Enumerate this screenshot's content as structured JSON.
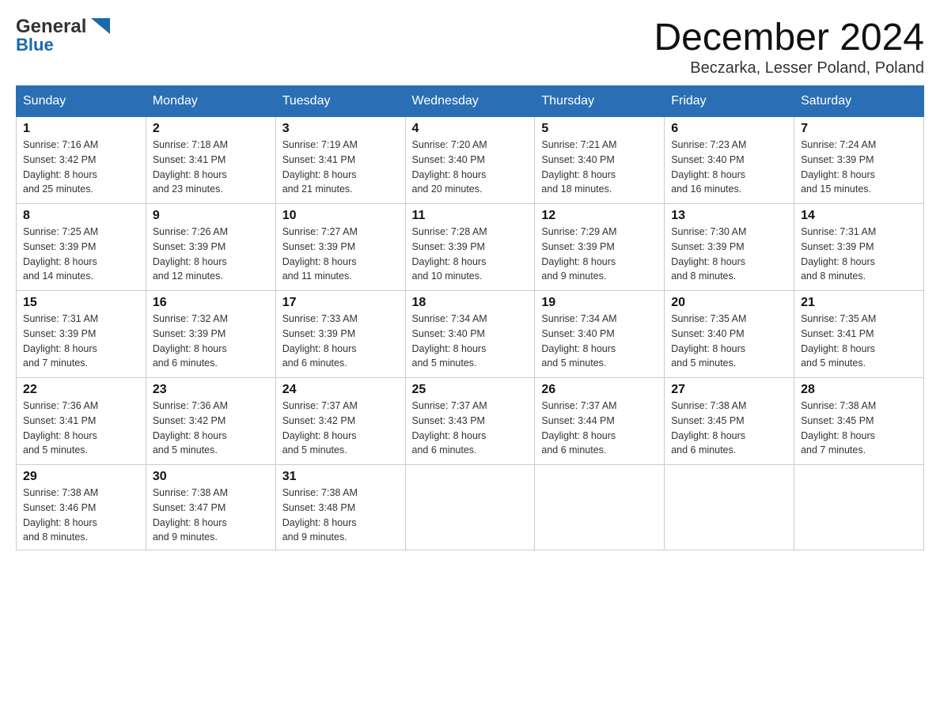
{
  "logo": {
    "general": "General",
    "blue": "Blue"
  },
  "title": "December 2024",
  "subtitle": "Beczarka, Lesser Poland, Poland",
  "days": [
    "Sunday",
    "Monday",
    "Tuesday",
    "Wednesday",
    "Thursday",
    "Friday",
    "Saturday"
  ],
  "weeks": [
    [
      {
        "num": "1",
        "sunrise": "7:16 AM",
        "sunset": "3:42 PM",
        "daylight": "8 hours and 25 minutes."
      },
      {
        "num": "2",
        "sunrise": "7:18 AM",
        "sunset": "3:41 PM",
        "daylight": "8 hours and 23 minutes."
      },
      {
        "num": "3",
        "sunrise": "7:19 AM",
        "sunset": "3:41 PM",
        "daylight": "8 hours and 21 minutes."
      },
      {
        "num": "4",
        "sunrise": "7:20 AM",
        "sunset": "3:40 PM",
        "daylight": "8 hours and 20 minutes."
      },
      {
        "num": "5",
        "sunrise": "7:21 AM",
        "sunset": "3:40 PM",
        "daylight": "8 hours and 18 minutes."
      },
      {
        "num": "6",
        "sunrise": "7:23 AM",
        "sunset": "3:40 PM",
        "daylight": "8 hours and 16 minutes."
      },
      {
        "num": "7",
        "sunrise": "7:24 AM",
        "sunset": "3:39 PM",
        "daylight": "8 hours and 15 minutes."
      }
    ],
    [
      {
        "num": "8",
        "sunrise": "7:25 AM",
        "sunset": "3:39 PM",
        "daylight": "8 hours and 14 minutes."
      },
      {
        "num": "9",
        "sunrise": "7:26 AM",
        "sunset": "3:39 PM",
        "daylight": "8 hours and 12 minutes."
      },
      {
        "num": "10",
        "sunrise": "7:27 AM",
        "sunset": "3:39 PM",
        "daylight": "8 hours and 11 minutes."
      },
      {
        "num": "11",
        "sunrise": "7:28 AM",
        "sunset": "3:39 PM",
        "daylight": "8 hours and 10 minutes."
      },
      {
        "num": "12",
        "sunrise": "7:29 AM",
        "sunset": "3:39 PM",
        "daylight": "8 hours and 9 minutes."
      },
      {
        "num": "13",
        "sunrise": "7:30 AM",
        "sunset": "3:39 PM",
        "daylight": "8 hours and 8 minutes."
      },
      {
        "num": "14",
        "sunrise": "7:31 AM",
        "sunset": "3:39 PM",
        "daylight": "8 hours and 8 minutes."
      }
    ],
    [
      {
        "num": "15",
        "sunrise": "7:31 AM",
        "sunset": "3:39 PM",
        "daylight": "8 hours and 7 minutes."
      },
      {
        "num": "16",
        "sunrise": "7:32 AM",
        "sunset": "3:39 PM",
        "daylight": "8 hours and 6 minutes."
      },
      {
        "num": "17",
        "sunrise": "7:33 AM",
        "sunset": "3:39 PM",
        "daylight": "8 hours and 6 minutes."
      },
      {
        "num": "18",
        "sunrise": "7:34 AM",
        "sunset": "3:40 PM",
        "daylight": "8 hours and 5 minutes."
      },
      {
        "num": "19",
        "sunrise": "7:34 AM",
        "sunset": "3:40 PM",
        "daylight": "8 hours and 5 minutes."
      },
      {
        "num": "20",
        "sunrise": "7:35 AM",
        "sunset": "3:40 PM",
        "daylight": "8 hours and 5 minutes."
      },
      {
        "num": "21",
        "sunrise": "7:35 AM",
        "sunset": "3:41 PM",
        "daylight": "8 hours and 5 minutes."
      }
    ],
    [
      {
        "num": "22",
        "sunrise": "7:36 AM",
        "sunset": "3:41 PM",
        "daylight": "8 hours and 5 minutes."
      },
      {
        "num": "23",
        "sunrise": "7:36 AM",
        "sunset": "3:42 PM",
        "daylight": "8 hours and 5 minutes."
      },
      {
        "num": "24",
        "sunrise": "7:37 AM",
        "sunset": "3:42 PM",
        "daylight": "8 hours and 5 minutes."
      },
      {
        "num": "25",
        "sunrise": "7:37 AM",
        "sunset": "3:43 PM",
        "daylight": "8 hours and 6 minutes."
      },
      {
        "num": "26",
        "sunrise": "7:37 AM",
        "sunset": "3:44 PM",
        "daylight": "8 hours and 6 minutes."
      },
      {
        "num": "27",
        "sunrise": "7:38 AM",
        "sunset": "3:45 PM",
        "daylight": "8 hours and 6 minutes."
      },
      {
        "num": "28",
        "sunrise": "7:38 AM",
        "sunset": "3:45 PM",
        "daylight": "8 hours and 7 minutes."
      }
    ],
    [
      {
        "num": "29",
        "sunrise": "7:38 AM",
        "sunset": "3:46 PM",
        "daylight": "8 hours and 8 minutes."
      },
      {
        "num": "30",
        "sunrise": "7:38 AM",
        "sunset": "3:47 PM",
        "daylight": "8 hours and 9 minutes."
      },
      {
        "num": "31",
        "sunrise": "7:38 AM",
        "sunset": "3:48 PM",
        "daylight": "8 hours and 9 minutes."
      },
      null,
      null,
      null,
      null
    ]
  ],
  "labels": {
    "sunrise": "Sunrise:",
    "sunset": "Sunset:",
    "daylight": "Daylight:"
  }
}
